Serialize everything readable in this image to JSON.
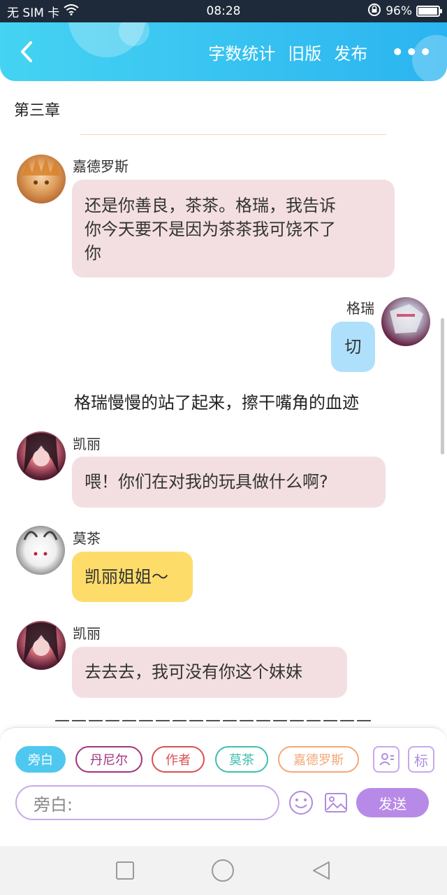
{
  "status": {
    "carrier": "无 SIM 卡",
    "time": "08:28",
    "battery": "96%",
    "battery_level": 0.96
  },
  "header": {
    "word_count": "字数统计",
    "old_version": "旧版",
    "publish": "发布"
  },
  "chapter_title": "第三章",
  "messages": [
    {
      "speaker": "嘉德罗斯",
      "text_lines": [
        "还是你善良，茶茶。格瑞，我告诉",
        "你今天要不是因为茶茶我可饶不了",
        "你"
      ]
    },
    {
      "speaker": "格瑞",
      "text": "切"
    },
    {
      "narration": "格瑞慢慢的站了起来，擦干嘴角的血迹"
    },
    {
      "speaker": "凯丽",
      "text": "喂！你们在对我的玩具做什么啊?"
    },
    {
      "speaker": "莫茶",
      "text": "凯丽姐姐～"
    },
    {
      "speaker": "凯丽",
      "text": "去去去，我可没有你这个妹妹"
    }
  ],
  "separator": "———————————————————",
  "roles": [
    {
      "label": "旁白",
      "color": "#4fc8f0",
      "selected": true
    },
    {
      "label": "丹尼尔",
      "color": "#a0337e"
    },
    {
      "label": "作者",
      "color": "#d95050"
    },
    {
      "label": "莫茶",
      "color": "#3dbfb0"
    },
    {
      "label": "嘉德罗斯",
      "color": "#f0a878"
    }
  ],
  "mark_button": "标",
  "input_placeholder": "旁白:",
  "send_label": "发送",
  "colors": {
    "accent": "#2bb4f0",
    "purple": "#b88ae8"
  }
}
